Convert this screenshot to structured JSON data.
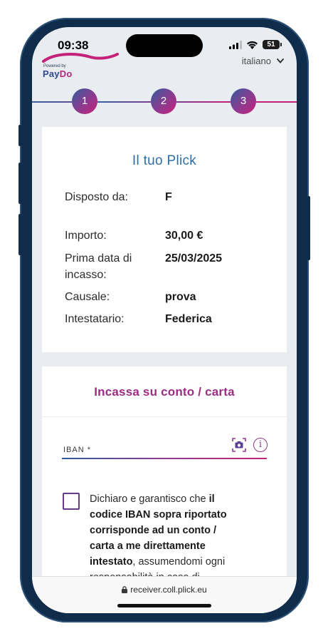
{
  "status_bar": {
    "time": "09:38",
    "battery": "51"
  },
  "header": {
    "logo_powered": "Powered by",
    "logo_pay": "Pay",
    "logo_do": "Do",
    "language": "italiano"
  },
  "stepper": {
    "steps": [
      "1",
      "2",
      "3"
    ]
  },
  "summary": {
    "title": "Il tuo Plick",
    "rows": [
      {
        "label": "Disposto da:",
        "value": "F"
      },
      {
        "label": "Importo:",
        "value": "30,00 €"
      },
      {
        "label": "Prima data di incasso:",
        "value": "25/03/2025"
      },
      {
        "label": "Causale:",
        "value": "prova"
      },
      {
        "label": "Intestatario:",
        "value": "Federica"
      }
    ]
  },
  "payout": {
    "title": "Incassa su conto / carta",
    "iban_label": "IBAN *",
    "consent_part1": "Dichiaro e garantisco che ",
    "consent_bold": "il codice IBAN sopra riportato corrisponde ad un conto / carta a me direttamente intestato",
    "consent_part2": ", assumendomi ogni responsabilità in caso di"
  },
  "browser": {
    "url": "receiver.coll.plick.eu"
  }
}
